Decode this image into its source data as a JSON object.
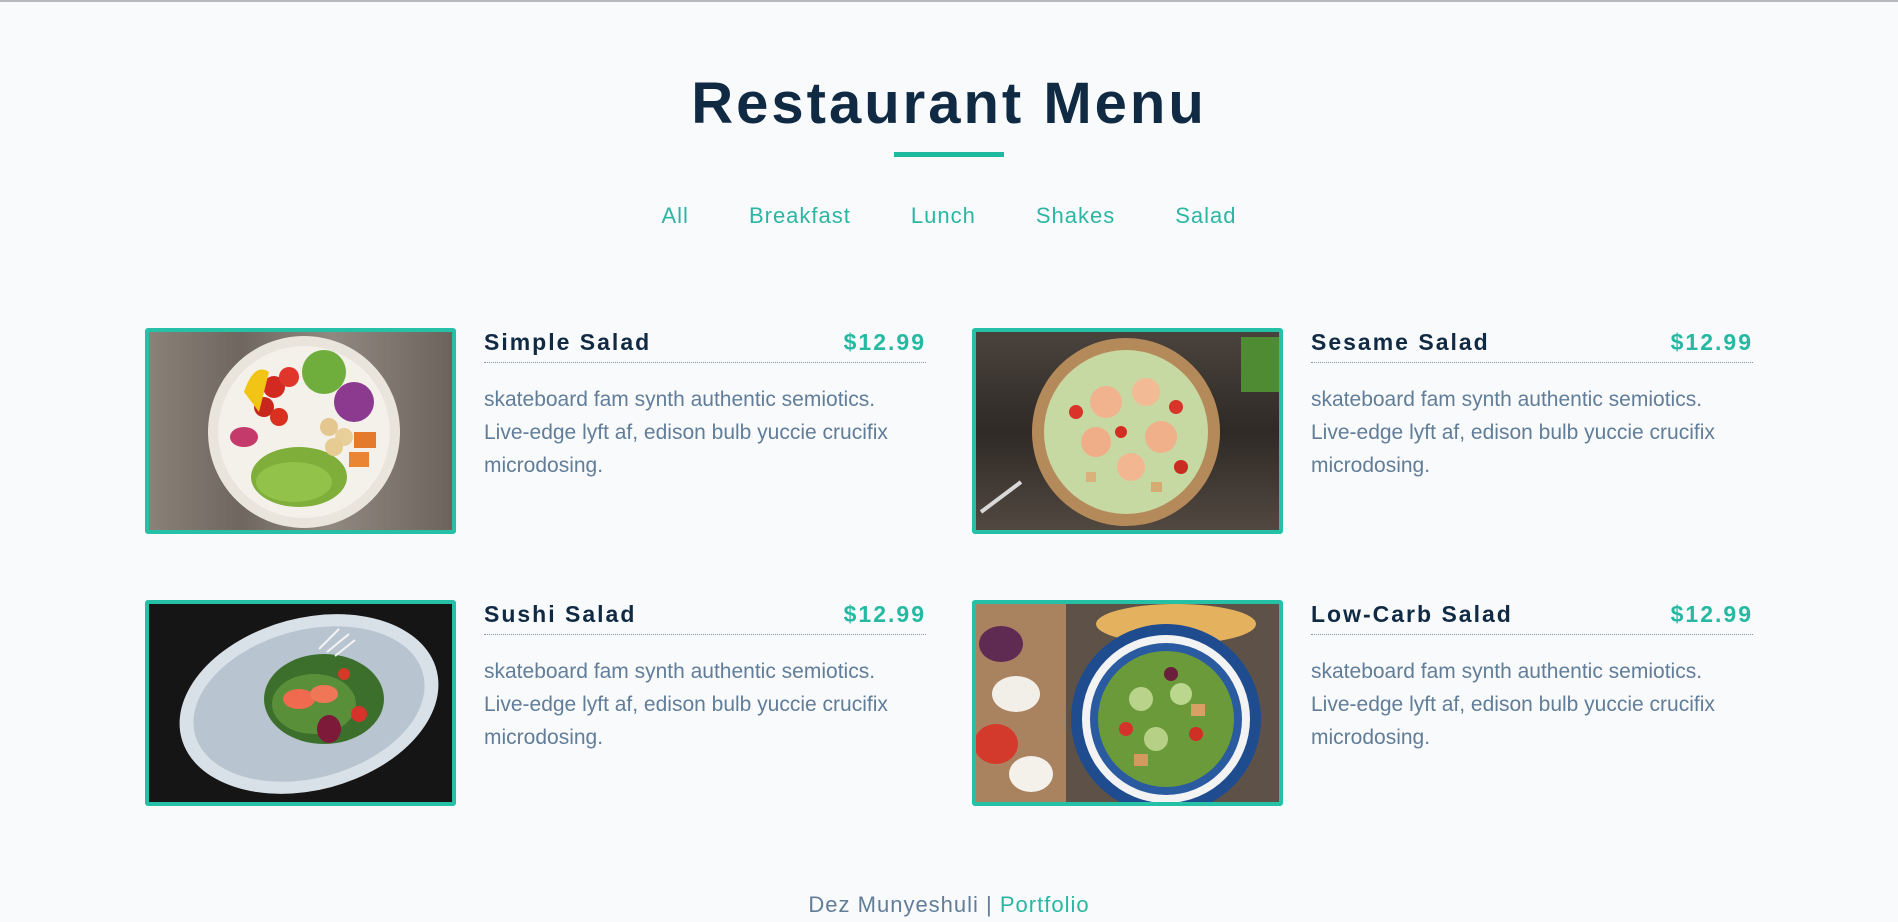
{
  "header": {
    "title": "Restaurant Menu"
  },
  "filters": [
    "All",
    "Breakfast",
    "Lunch",
    "Shakes",
    "Salad"
  ],
  "items": [
    {
      "name": "Simple Salad",
      "price": "$12.99",
      "desc": "skateboard fam synth authentic semiotics. Live-edge lyft af, edison bulb yuccie crucifix microdosing.",
      "image": "salad-bowl-vegetables-image"
    },
    {
      "name": "Sesame Salad",
      "price": "$12.99",
      "desc": "skateboard fam synth authentic semiotics. Live-edge lyft af, edison bulb yuccie crucifix microdosing.",
      "image": "shrimp-salad-bowl-image"
    },
    {
      "name": "Sushi Salad",
      "price": "$12.99",
      "desc": "skateboard fam synth authentic semiotics. Live-edge lyft af, edison bulb yuccie crucifix microdosing.",
      "image": "sushi-salad-plate-image"
    },
    {
      "name": "Low-Carb Salad",
      "price": "$12.99",
      "desc": "skateboard fam synth authentic semiotics. Live-edge lyft af, edison bulb yuccie crucifix microdosing.",
      "image": "low-carb-salad-bowl-image"
    }
  ],
  "footer": {
    "author": "Dez Munyeshuli",
    "separator": " | ",
    "link": "Portfolio"
  },
  "colors": {
    "accent": "#25c0a5",
    "title": "#102a43",
    "text": "#617d98",
    "background": "#f8fafc"
  }
}
